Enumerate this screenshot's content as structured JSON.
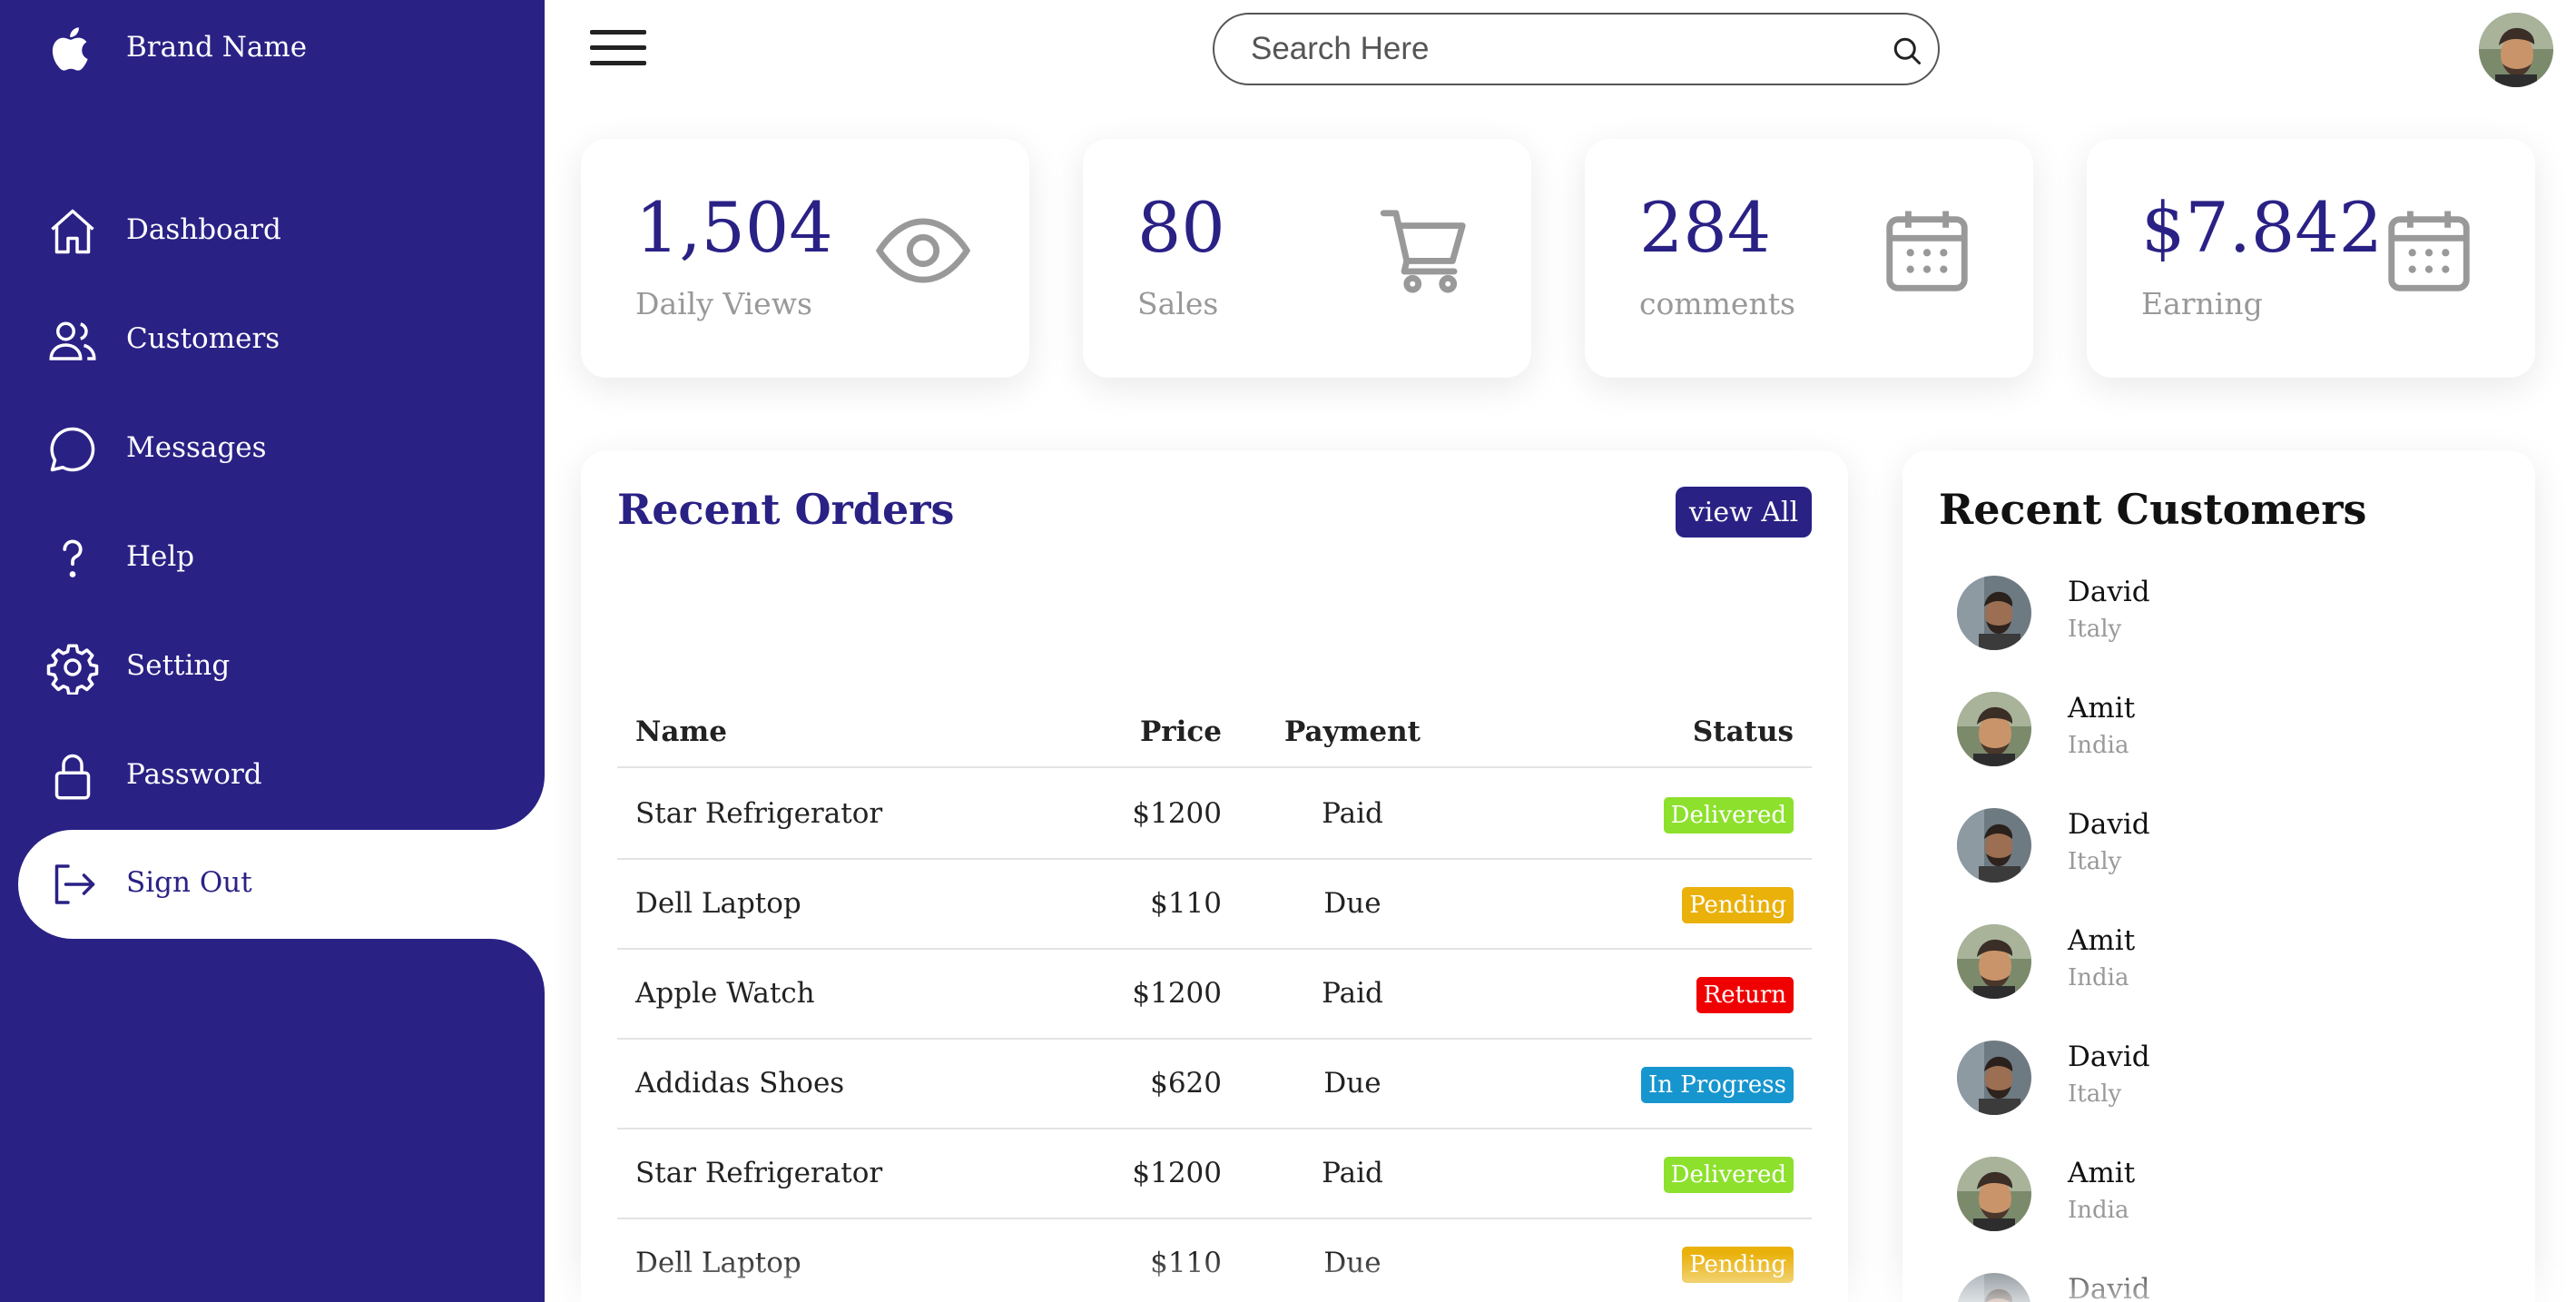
{
  "brand": {
    "name": "Brand Name",
    "icon": "apple-icon"
  },
  "sidebar": {
    "items": [
      {
        "label": "Dashboard",
        "icon": "home-icon"
      },
      {
        "label": "Customers",
        "icon": "users-icon"
      },
      {
        "label": "Messages",
        "icon": "chat-icon"
      },
      {
        "label": "Help",
        "icon": "help-icon"
      },
      {
        "label": "Setting",
        "icon": "gear-icon"
      },
      {
        "label": "Password",
        "icon": "lock-icon"
      },
      {
        "label": "Sign Out",
        "icon": "sign-out-icon",
        "active": true
      }
    ]
  },
  "search": {
    "placeholder": "Search Here",
    "value": ""
  },
  "cards": [
    {
      "number": "1,504",
      "label": "Daily Views",
      "icon": "eye-icon"
    },
    {
      "number": "80",
      "label": "Sales",
      "icon": "cart-icon"
    },
    {
      "number": "284",
      "label": "comments",
      "icon": "calendar-icon"
    },
    {
      "number": "$7.842",
      "label": "Earning",
      "icon": "calendar-icon"
    }
  ],
  "orders": {
    "title": "Recent Orders",
    "view_all": "view All",
    "columns": [
      "Name",
      "Price",
      "Payment",
      "Status"
    ],
    "rows": [
      {
        "name": "Star Refrigerator",
        "price": "$1200",
        "payment": "Paid",
        "status": "Delivered",
        "status_color": "#8de02c"
      },
      {
        "name": "Dell Laptop",
        "price": "$110",
        "payment": "Due",
        "status": "Pending",
        "status_color": "#e9b10a"
      },
      {
        "name": "Apple Watch",
        "price": "$1200",
        "payment": "Paid",
        "status": "Return",
        "status_color": "#f00000"
      },
      {
        "name": "Addidas Shoes",
        "price": "$620",
        "payment": "Due",
        "status": "In Progress",
        "status_color": "#1795ce"
      },
      {
        "name": "Star Refrigerator",
        "price": "$1200",
        "payment": "Paid",
        "status": "Delivered",
        "status_color": "#8de02c"
      },
      {
        "name": "Dell Laptop",
        "price": "$110",
        "payment": "Due",
        "status": "Pending",
        "status_color": "#e9b10a"
      }
    ]
  },
  "customers": {
    "title": "Recent Customers",
    "list": [
      {
        "name": "David",
        "country": "Italy"
      },
      {
        "name": "Amit",
        "country": "India"
      },
      {
        "name": "David",
        "country": "Italy"
      },
      {
        "name": "Amit",
        "country": "India"
      },
      {
        "name": "David",
        "country": "Italy"
      },
      {
        "name": "Amit",
        "country": "India"
      },
      {
        "name": "David",
        "country": ""
      }
    ]
  },
  "colors": {
    "primary": "#2a2185",
    "muted": "#999999"
  }
}
